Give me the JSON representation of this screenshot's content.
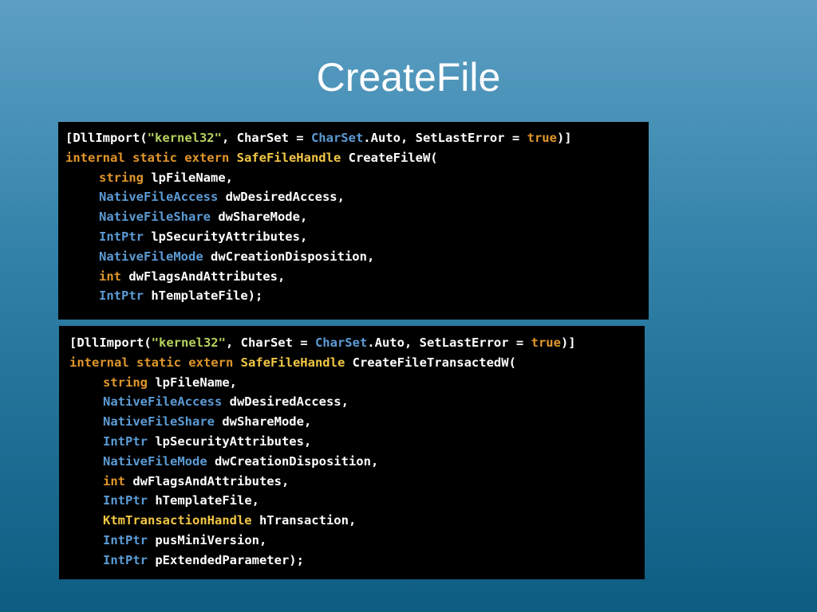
{
  "slide": {
    "title": "CreateFile"
  },
  "colors": {
    "plain": "#ffffff",
    "keyword": "#e0962a",
    "string": "#b5d15e",
    "type": "#5b9bd5",
    "class": "#f2c744",
    "panel_bg": "#000000"
  },
  "code_blocks": [
    {
      "lines": [
        {
          "indent": 0,
          "tokens": [
            {
              "t": "[DllImport(",
              "k": "plain"
            },
            {
              "t": "\"kernel32\"",
              "k": "string"
            },
            {
              "t": ", CharSet = ",
              "k": "plain"
            },
            {
              "t": "CharSet",
              "k": "type"
            },
            {
              "t": ".Auto, SetLastError = ",
              "k": "plain"
            },
            {
              "t": "true",
              "k": "keyword"
            },
            {
              "t": ")]",
              "k": "plain"
            }
          ]
        },
        {
          "indent": 0,
          "tokens": [
            {
              "t": "internal static extern ",
              "k": "keyword"
            },
            {
              "t": "SafeFileHandle",
              "k": "class"
            },
            {
              "t": " CreateFileW(",
              "k": "plain"
            }
          ]
        },
        {
          "indent": 1,
          "tokens": [
            {
              "t": "string",
              "k": "keyword"
            },
            {
              "t": " lpFileName,",
              "k": "plain"
            }
          ]
        },
        {
          "indent": 1,
          "tokens": [
            {
              "t": "NativeFileAccess",
              "k": "type"
            },
            {
              "t": " dwDesiredAccess,",
              "k": "plain"
            }
          ]
        },
        {
          "indent": 1,
          "tokens": [
            {
              "t": "NativeFileShare",
              "k": "type"
            },
            {
              "t": " dwShareMode,",
              "k": "plain"
            }
          ]
        },
        {
          "indent": 1,
          "tokens": [
            {
              "t": "IntPtr",
              "k": "type"
            },
            {
              "t": " lpSecurityAttributes,",
              "k": "plain"
            }
          ]
        },
        {
          "indent": 1,
          "tokens": [
            {
              "t": "NativeFileMode",
              "k": "type"
            },
            {
              "t": " dwCreationDisposition,",
              "k": "plain"
            }
          ]
        },
        {
          "indent": 1,
          "tokens": [
            {
              "t": "int",
              "k": "keyword"
            },
            {
              "t": " dwFlagsAndAttributes,",
              "k": "plain"
            }
          ]
        },
        {
          "indent": 1,
          "tokens": [
            {
              "t": "IntPtr",
              "k": "type"
            },
            {
              "t": " hTemplateFile);",
              "k": "plain"
            }
          ]
        }
      ]
    },
    {
      "lines": [
        {
          "indent": 0,
          "tokens": [
            {
              "t": "[DllImport(",
              "k": "plain"
            },
            {
              "t": "\"kernel32\"",
              "k": "string"
            },
            {
              "t": ", CharSet = ",
              "k": "plain"
            },
            {
              "t": "CharSet",
              "k": "type"
            },
            {
              "t": ".Auto, SetLastError = ",
              "k": "plain"
            },
            {
              "t": "true",
              "k": "keyword"
            },
            {
              "t": ")]",
              "k": "plain"
            }
          ]
        },
        {
          "indent": 0,
          "tokens": [
            {
              "t": "internal static extern ",
              "k": "keyword"
            },
            {
              "t": "SafeFileHandle",
              "k": "class"
            },
            {
              "t": " CreateFileTransactedW(",
              "k": "plain"
            }
          ]
        },
        {
          "indent": 1,
          "tokens": [
            {
              "t": "string",
              "k": "keyword"
            },
            {
              "t": " lpFileName,",
              "k": "plain"
            }
          ]
        },
        {
          "indent": 1,
          "tokens": [
            {
              "t": "NativeFileAccess",
              "k": "type"
            },
            {
              "t": " dwDesiredAccess,",
              "k": "plain"
            }
          ]
        },
        {
          "indent": 1,
          "tokens": [
            {
              "t": "NativeFileShare",
              "k": "type"
            },
            {
              "t": " dwShareMode,",
              "k": "plain"
            }
          ]
        },
        {
          "indent": 1,
          "tokens": [
            {
              "t": "IntPtr",
              "k": "type"
            },
            {
              "t": " lpSecurityAttributes,",
              "k": "plain"
            }
          ]
        },
        {
          "indent": 1,
          "tokens": [
            {
              "t": "NativeFileMode",
              "k": "type"
            },
            {
              "t": " dwCreationDisposition,",
              "k": "plain"
            }
          ]
        },
        {
          "indent": 1,
          "tokens": [
            {
              "t": "int",
              "k": "keyword"
            },
            {
              "t": " dwFlagsAndAttributes,",
              "k": "plain"
            }
          ]
        },
        {
          "indent": 1,
          "tokens": [
            {
              "t": "IntPtr",
              "k": "type"
            },
            {
              "t": " hTemplateFile,",
              "k": "plain"
            }
          ]
        },
        {
          "indent": 1,
          "tokens": [
            {
              "t": "KtmTransactionHandle",
              "k": "class"
            },
            {
              "t": " hTransaction,",
              "k": "plain"
            }
          ]
        },
        {
          "indent": 1,
          "tokens": [
            {
              "t": "IntPtr",
              "k": "type"
            },
            {
              "t": " pusMiniVersion,",
              "k": "plain"
            }
          ]
        },
        {
          "indent": 1,
          "tokens": [
            {
              "t": "IntPtr",
              "k": "type"
            },
            {
              "t": " pExtendedParameter);",
              "k": "plain"
            }
          ]
        }
      ]
    }
  ]
}
